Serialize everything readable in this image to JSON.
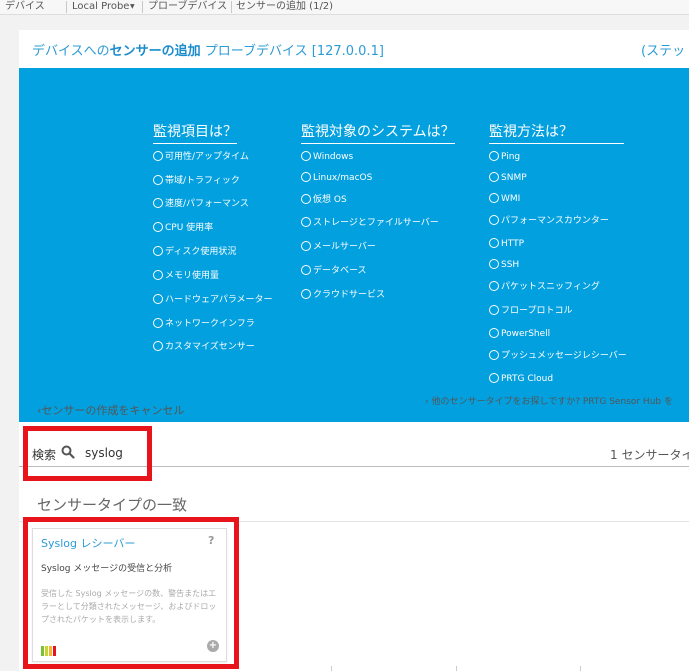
{
  "breadcrumb": {
    "items": [
      "デバイス",
      "Local Probe",
      "プローブデバイス",
      "センサーの追加 (1/2)"
    ]
  },
  "header": {
    "title_prefix": "デバイスへの",
    "title_bold": "センサーの追加",
    "title_suffix": "プローブデバイス [127.0.0.1]",
    "step_label": "(ステッ"
  },
  "filters": {
    "columns": [
      {
        "heading": "監視項目は？",
        "options": [
          "可用性/アップタイム",
          "帯域/トラフィック",
          "速度/パフォーマンス",
          "CPU 使用率",
          "ディスク使用状況",
          "メモリ使用量",
          "ハードウェアパラメーター",
          "ネットワークインフラ",
          "カスタマイズセンサー"
        ]
      },
      {
        "heading": "監視対象のシステムは？",
        "options": [
          "Windows",
          "Linux/macOS",
          "仮想 OS",
          "ストレージとファイルサーバー",
          "メールサーバー",
          "データベース",
          "クラウドサービス"
        ]
      },
      {
        "heading": "監視方法は？",
        "options": [
          "Ping",
          "SNMP",
          "WMI",
          "パフォーマンスカウンター",
          "HTTP",
          "SSH",
          "パケットスニッフィング",
          "フロープロトコル",
          "PowerShell",
          "プッシュメッセージレシーバー",
          "PRTG Cloud"
        ]
      }
    ]
  },
  "links": {
    "cancel": "センサーの作成をキャンセル",
    "hub": "他のセンサータイプをお探しですか? PRTG Sensor Hub を"
  },
  "search": {
    "label": "検索",
    "value": "syslog",
    "result_count": "1 センサータイ"
  },
  "results": {
    "section_title": "センサータイプの一致",
    "cards": [
      {
        "title": "Syslog レシーバー",
        "help": "?",
        "subtitle": "Syslog メッセージの受信と分析",
        "description": "受信した Syslog メッセージの数、警告またはエラーとして分類されたメッセージ、およびドロップされたパケットを表示します。",
        "add": "+",
        "bar_colors": [
          "#7cbf3a",
          "#c8d530",
          "#f2b92f",
          "#e8141b"
        ]
      }
    ]
  },
  "colors": {
    "accent": "#03a0df",
    "link": "#2b9bd6",
    "highlight": "#e8141b"
  }
}
